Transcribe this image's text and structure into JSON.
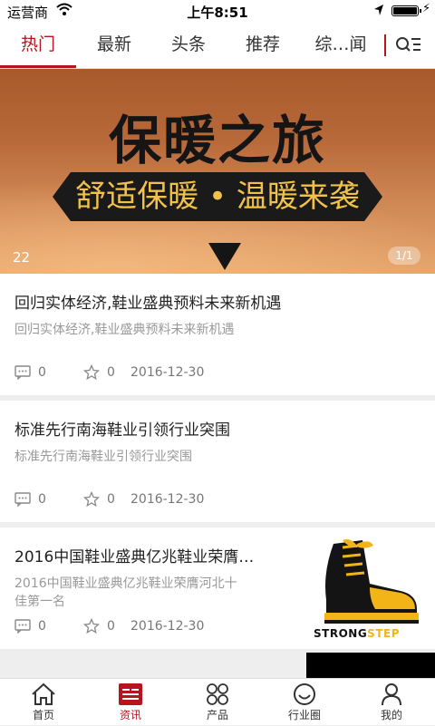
{
  "status_bar": {
    "carrier": "运营商",
    "time": "上午8:51"
  },
  "tabs": [
    {
      "label": "热门",
      "active": true
    },
    {
      "label": "最新",
      "active": false
    },
    {
      "label": "头条",
      "active": false
    },
    {
      "label": "推荐",
      "active": false
    },
    {
      "label": "综…闻",
      "active": false
    }
  ],
  "banner": {
    "title": "保暖之旅",
    "subtitle": "舒适保暖 • 温暖来袭",
    "caption": "22",
    "pager": "1/1"
  },
  "news": [
    {
      "title": "回归实体经济,鞋业盛典预料未来新机遇",
      "summary": "回归实体经济,鞋业盛典预料未来新机遇",
      "comments": "0",
      "likes": "0",
      "date": "2016-12-30"
    },
    {
      "title": "标准先行南海鞋业引领行业突围",
      "summary": "标准先行南海鞋业引领行业突围",
      "comments": "0",
      "likes": "0",
      "date": "2016-12-30"
    },
    {
      "title": "2016中国鞋业盛典亿兆鞋业荣膺…",
      "summary_line1": "2016中国鞋业盛典亿兆鞋业荣膺河北十",
      "summary_line2": "佳第一名",
      "comments": "0",
      "likes": "0",
      "date": "2016-12-30",
      "thumb_brand_a": "STRONG",
      "thumb_brand_b": "STEP"
    }
  ],
  "tabbar": [
    {
      "label": "首页",
      "icon": "home-icon",
      "active": false
    },
    {
      "label": "资讯",
      "icon": "news-icon",
      "active": true
    },
    {
      "label": "产品",
      "icon": "products-icon",
      "active": false
    },
    {
      "label": "行业圈",
      "icon": "circle-icon",
      "active": false
    },
    {
      "label": "我的",
      "icon": "profile-icon",
      "active": false
    }
  ],
  "colors": {
    "accent": "#b4151f",
    "banner_text_yellow": "#f2c14a"
  }
}
